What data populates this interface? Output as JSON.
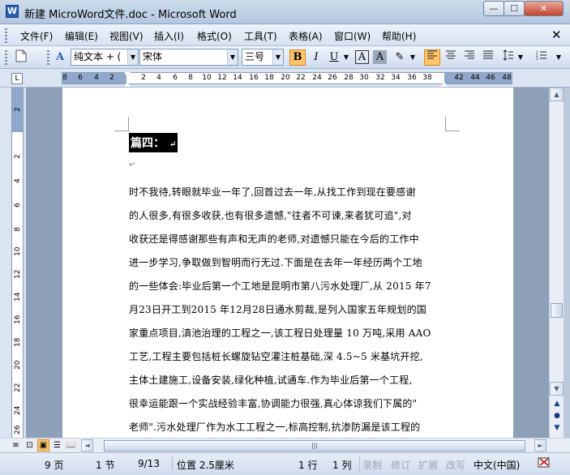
{
  "window": {
    "title": "新建 MicroWord文件.doc - Microsoft Word",
    "icon_label": "W",
    "minimize": "—",
    "maximize": "☐",
    "close": "✕"
  },
  "menu": {
    "items": [
      "文件(F)",
      "编辑(E)",
      "视图(V)",
      "插入(I)",
      "格式(O)",
      "工具(T)",
      "表格(A)",
      "窗口(W)",
      "帮助(H)"
    ],
    "close": "✕"
  },
  "toolbar": {
    "style_value": "纯文本 + (",
    "font_value": "宋体",
    "size_value": "三号",
    "bold": "B",
    "italic": "I",
    "underline": "U",
    "char_border": "A",
    "char_shading": "A",
    "highlight": "✎",
    "new_doc_icon": "📄",
    "styles_icon": "A"
  },
  "ruler": {
    "numbers": [
      "8",
      "6",
      "4",
      "2",
      "2",
      "4",
      "6",
      "8",
      "10",
      "12",
      "14",
      "16",
      "18",
      "20",
      "22",
      "24",
      "26",
      "28",
      "30",
      "32",
      "34",
      "36",
      "38",
      "42",
      "44",
      "46",
      "48"
    ],
    "corner": "L"
  },
  "vruler": {
    "numbers": [
      "2",
      "2",
      "4",
      "6",
      "8",
      "10",
      "12",
      "14",
      "16",
      "18",
      "20",
      "22",
      "24",
      "26"
    ]
  },
  "document": {
    "heading": "篇四：",
    "lines": [
      "时不我待,转眼就毕业一年了,回首过去一年,从找工作到现在要感谢",
      "的人很多,有很多收获,也有很多遗憾,\"往者不可谏,来者犹可追\",对",
      "收获还是得感谢那些有声和无声的老师,对遗憾只能在今后的工作中",
      "进一步学习,争取做到智明而行无过.下面是在去年一年经历两个工地",
      "的一些体会:毕业后第一个工地是昆明市第八污水处理厂,从 2015 年7",
      "月23日开工到2015 年12月28日通水剪裁,是列入国家五年规划的国",
      "家重点项目,滇池治理的工程之一,该工程日处理量 10 万吨,采用 AAO",
      "工艺,工程主要包括桩长螺旋钻空灌注桩基础,深 4.5~5 米基坑开挖,",
      "主体土建施工,设备安装,绿化种植,试通车.作为毕业后第一个工程,",
      "很幸运能跟一个实战经验丰富,协调能力很强,真心体谅我们下属的\"",
      "老师\".污水处理厂作为水工工程之一,标高控制,抗渗防漏是该工程的"
    ],
    "para_mark": "↵"
  },
  "status": {
    "page": "9 页",
    "section": "1 节",
    "pages": "9/13",
    "position": "位置 2.5厘米",
    "line": "1 行",
    "col": "1 列",
    "rec": "录制",
    "trk": "修订",
    "ext": "扩展",
    "ovr": "改写",
    "lang": "中文(中国)"
  }
}
